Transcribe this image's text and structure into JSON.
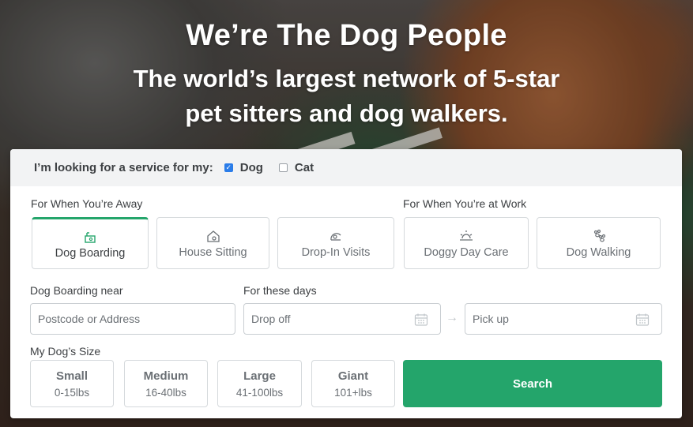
{
  "hero": {
    "title": "We’re The Dog People",
    "subtitle_line1": "The world’s largest network of 5-star",
    "subtitle_line2": "pet sitters and dog walkers."
  },
  "pet_selector": {
    "prompt": "I’m looking for a service for my:",
    "options": [
      {
        "label": "Dog",
        "checked": true
      },
      {
        "label": "Cat",
        "checked": false
      }
    ]
  },
  "services": {
    "away_label": "For When You’re Away",
    "work_label": "For When You’re at Work",
    "items": [
      {
        "label": "Dog Boarding",
        "icon": "dog-boarding-icon",
        "selected": true
      },
      {
        "label": "House Sitting",
        "icon": "house-sitting-icon",
        "selected": false
      },
      {
        "label": "Drop-In Visits",
        "icon": "drop-in-visits-icon",
        "selected": false
      },
      {
        "label": "Doggy Day Care",
        "icon": "doggy-day-care-icon",
        "selected": false
      },
      {
        "label": "Dog Walking",
        "icon": "dog-walking-icon",
        "selected": false
      }
    ]
  },
  "location": {
    "label": "Dog Boarding near",
    "placeholder": "Postcode or Address"
  },
  "dates": {
    "label": "For these days",
    "dropoff_placeholder": "Drop off",
    "pickup_placeholder": "Pick up",
    "arrow": "→"
  },
  "dog_size": {
    "label": "My Dog’s Size",
    "options": [
      {
        "name": "Small",
        "range": "0-15lbs"
      },
      {
        "name": "Medium",
        "range": "16-40lbs"
      },
      {
        "name": "Large",
        "range": "41-100lbs"
      },
      {
        "name": "Giant",
        "range": "101+lbs"
      }
    ]
  },
  "search_label": "Search",
  "colors": {
    "accent_green": "#24a56b",
    "checkbox_blue": "#2b7de9"
  }
}
